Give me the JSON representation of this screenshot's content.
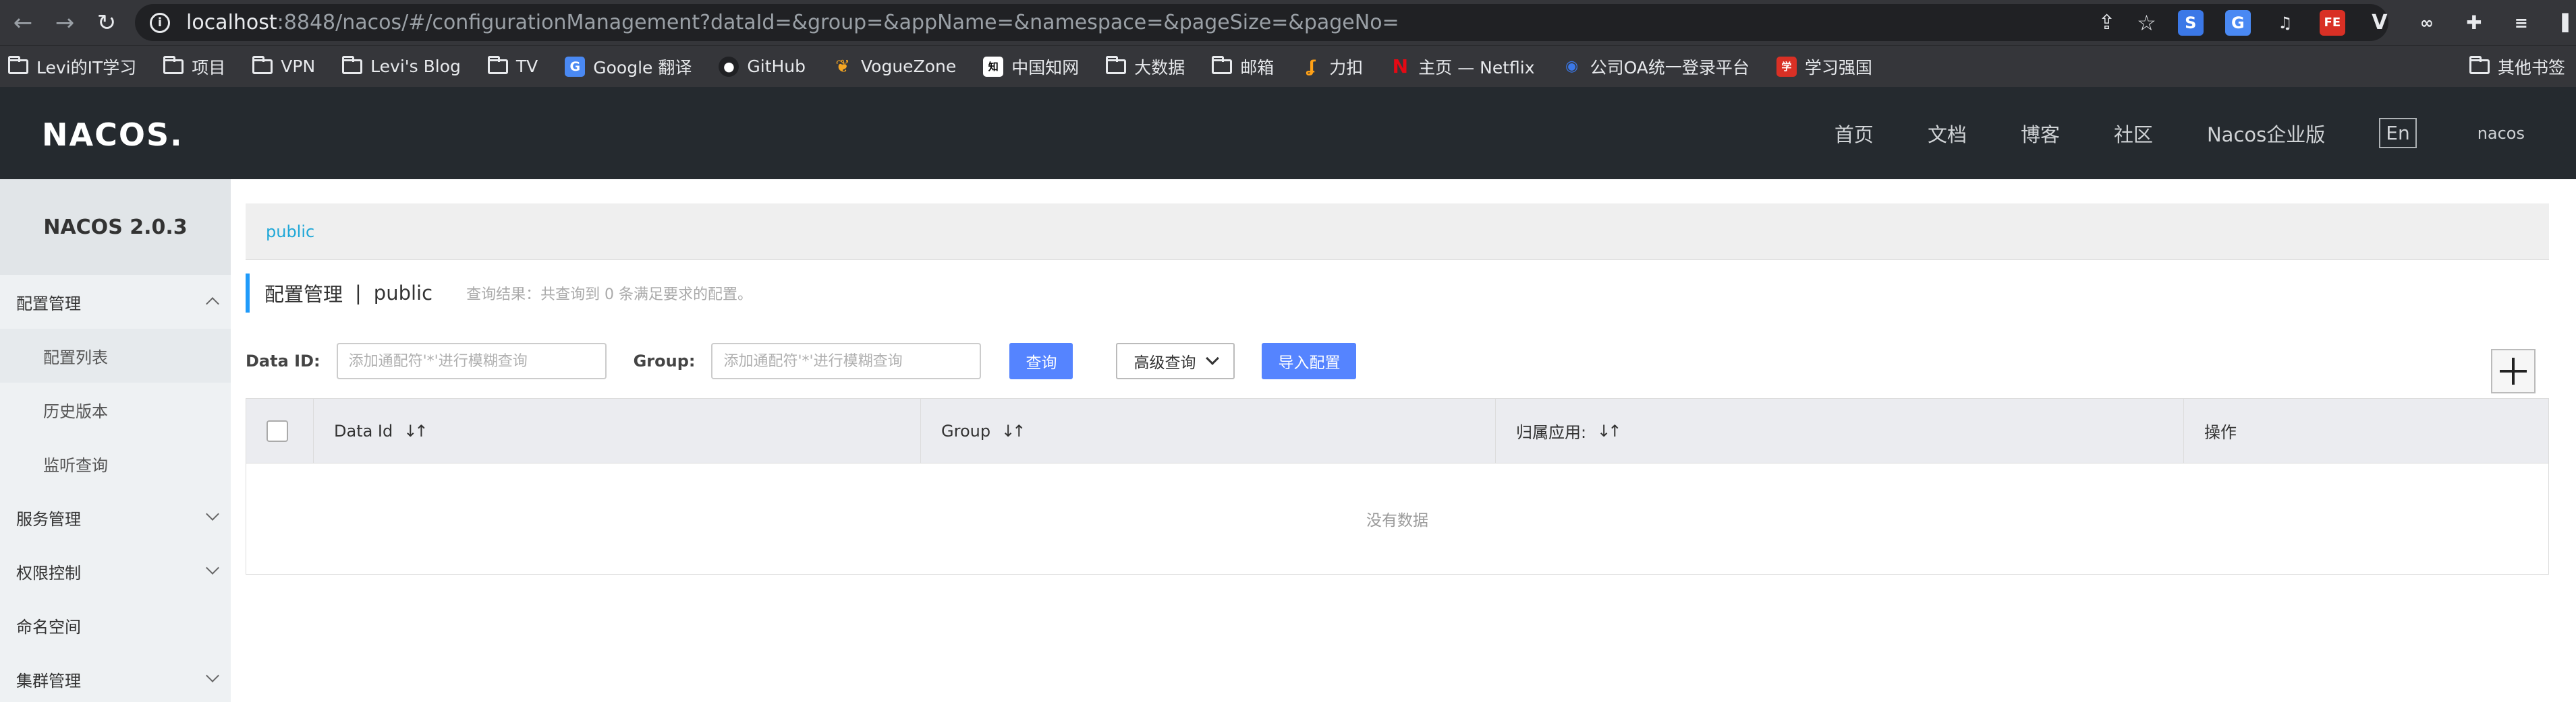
{
  "browser": {
    "url_host": "localhost",
    "url_rest": ":8848/nacos/#/configurationManagement?dataId=&group=&appName=&namespace=&pageSize=&pageNo=",
    "bookmarks": [
      {
        "label": "Levi的IT学习",
        "icon": "folder-icon"
      },
      {
        "label": "项目",
        "icon": "folder-icon"
      },
      {
        "label": "VPN",
        "icon": "folder-icon"
      },
      {
        "label": "Levi's Blog",
        "icon": "folder-icon"
      },
      {
        "label": "TV",
        "icon": "folder-icon"
      },
      {
        "label": "Google 翻译",
        "icon": "google-translate-icon"
      },
      {
        "label": "GitHub",
        "icon": "github-icon"
      },
      {
        "label": "VogueZone",
        "icon": "voguezone-icon"
      },
      {
        "label": "中国知网",
        "icon": "cnki-icon"
      },
      {
        "label": "大数据",
        "icon": "folder-icon"
      },
      {
        "label": "邮箱",
        "icon": "folder-icon"
      },
      {
        "label": "力扣",
        "icon": "leetcode-icon"
      },
      {
        "label": "主页 — Netflix",
        "icon": "netflix-icon"
      },
      {
        "label": "公司OA统一登录平台",
        "icon": "oa-icon"
      },
      {
        "label": "学习强国",
        "icon": "xuexi-icon"
      }
    ],
    "other_bookmarks": "其他书签"
  },
  "header": {
    "logo": "NACOS.",
    "nav": [
      "首页",
      "文档",
      "博客",
      "社区",
      "Nacos企业版"
    ],
    "lang": "En",
    "user": "nacos"
  },
  "sidebar": {
    "title": "NACOS 2.0.3",
    "items": [
      {
        "label": "配置管理",
        "level": 1,
        "expandable": true,
        "expanded": true
      },
      {
        "label": "配置列表",
        "level": 2,
        "active": true
      },
      {
        "label": "历史版本",
        "level": 2
      },
      {
        "label": "监听查询",
        "level": 2
      },
      {
        "label": "服务管理",
        "level": 1,
        "expandable": true,
        "expanded": false
      },
      {
        "label": "权限控制",
        "level": 1,
        "expandable": true,
        "expanded": false
      },
      {
        "label": "命名空间",
        "level": 1,
        "expandable": false
      },
      {
        "label": "集群管理",
        "level": 1,
        "expandable": true,
        "expanded": false
      }
    ]
  },
  "main": {
    "namespace_tab": "public",
    "title": "配置管理",
    "separator": "|",
    "namespace": "public",
    "query_result": "查询结果：共查询到 0 条满足要求的配置。",
    "filters": {
      "data_id_label": "Data ID:",
      "data_id_placeholder": "添加通配符'*'进行模糊查询",
      "group_label": "Group:",
      "group_placeholder": "添加通配符'*'进行模糊查询",
      "query_button": "查询",
      "advanced_button": "高级查询",
      "import_button": "导入配置"
    },
    "table": {
      "columns": [
        "Data Id",
        "Group",
        "归属应用:",
        "操作"
      ],
      "empty_text": "没有数据"
    }
  },
  "colors": {
    "accent": "#5584ff",
    "header_bg": "#252a2f",
    "link": "#1fa7d7"
  }
}
